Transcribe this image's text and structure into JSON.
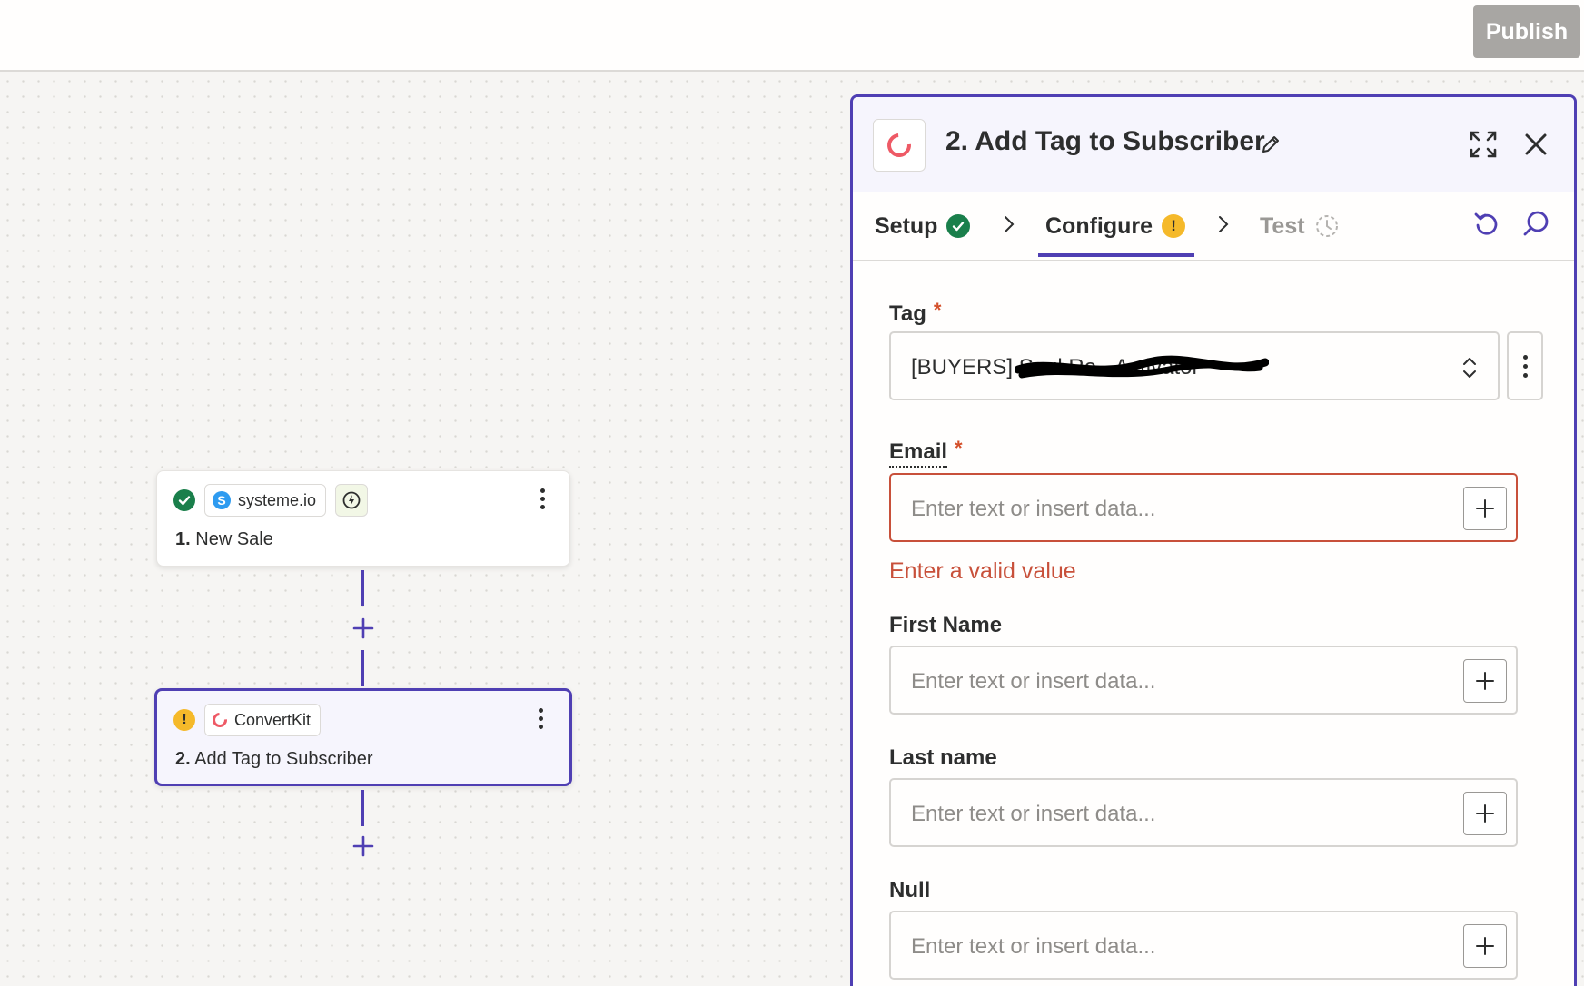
{
  "topbar": {
    "publish_label": "Publish"
  },
  "canvas": {
    "nodes": [
      {
        "app": "systeme.io",
        "step_number": "1.",
        "title": "New Sale",
        "status": "complete"
      },
      {
        "app": "ConvertKit",
        "step_number": "2.",
        "title": "Add Tag to Subscriber",
        "status": "warning"
      }
    ]
  },
  "panel": {
    "title": "2. Add Tag to Subscriber",
    "tabs": [
      {
        "label": "Setup",
        "state": "complete"
      },
      {
        "label": "Configure",
        "state": "warning"
      },
      {
        "label": "Test",
        "state": "pending"
      }
    ],
    "fields": {
      "tag": {
        "label": "Tag",
        "required": "*",
        "value": "[BUYERS] Soul Re...Activator"
      },
      "email": {
        "label": "Email",
        "required": "*",
        "placeholder": "Enter text or insert data...",
        "error": "Enter a valid value"
      },
      "first_name": {
        "label": "First Name",
        "placeholder": "Enter text or insert data..."
      },
      "last_name": {
        "label": "Last name",
        "placeholder": "Enter text or insert data..."
      },
      "null": {
        "label": "Null",
        "placeholder": "Enter text or insert data..."
      }
    }
  },
  "colors": {
    "accent": "#4f3fb3",
    "success": "#1a7f4b",
    "warning": "#f5b92a",
    "error": "#c8503a",
    "convertkit": "#ee5a66",
    "systeme": "#2e9bf0"
  }
}
